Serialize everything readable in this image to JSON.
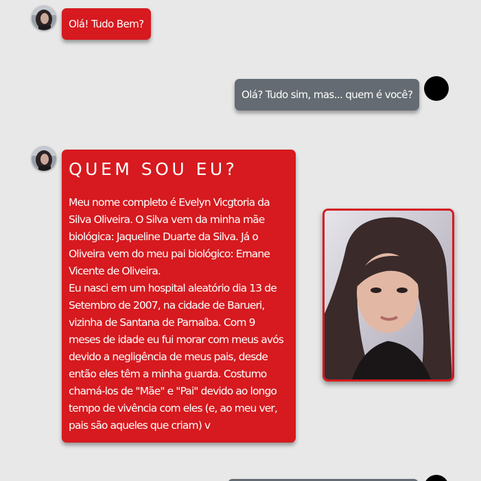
{
  "messages": {
    "greeting": "Olá! Tudo Bem?",
    "reply": "Olá? Tudo sim, mas... quem é você?",
    "bio_title": "QUEM SOU EU?",
    "bio_paragraph_1": "Meu nome completo é Evelyn Vicgtoria da Silva Oliveira. O Silva vem da minha mãe biológica: Jaqueline Duarte da Silva. Já o Oliveira vem do meu pai biológico: Ernane Vicente de Oliveira.",
    "bio_paragraph_2": "Eu nasci em um hospital aleatório dia 13 de Setembro de 2007, na cidade de Barueri, vizinha de Santana de Parnaíba. Com 9 meses de idade eu fui morar com meus avós devido a negligência de meus pais, desde então eles têm a minha guarda. Costumo chamá-los de \"Mãe\" e \"Pai\" devido ao longo tempo de vivência com eles (e, ao meu ver, pais são aqueles que criam) v"
  },
  "colors": {
    "background": "#e8e8e8",
    "bubble_red": "#d61a1f",
    "bubble_gray": "#646b72",
    "text": "#ffffff"
  },
  "icons": {
    "sender_avatar": "profile-photo-icon",
    "user_avatar": "black-circle-avatar-icon"
  }
}
